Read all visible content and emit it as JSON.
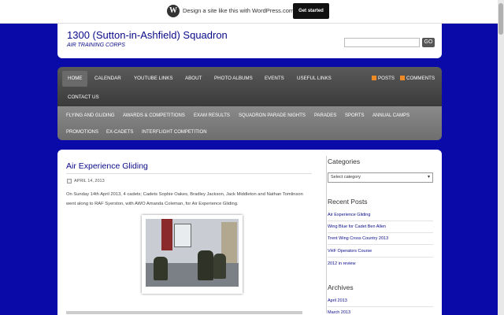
{
  "wpbar": {
    "logo_glyph": "W",
    "text": "Design a site like this with WordPress.com",
    "button": "Get started"
  },
  "header": {
    "title": "1300 (Sutton-in-Ashfield) Squadron",
    "tagline": "AIR TRAINING CORPS",
    "search_button_glyph": "GO"
  },
  "nav_primary": [
    "Home",
    "Calendar",
    "Youtube Links",
    "About",
    "Photo Albums",
    "Events",
    "Useful Links",
    "Contact Us"
  ],
  "feeds": {
    "posts": "Posts",
    "comments": "Comments"
  },
  "nav_secondary": [
    "Flying and Gliding",
    "Awards & Competitions",
    "Exam Results",
    "Squadron Parade Nights",
    "Parades",
    "Sports",
    "Annual Camps",
    "Promotions",
    "Ex-Cadets",
    "Interflight Competition"
  ],
  "post": {
    "title": "Air Experience Gliding",
    "date": "April 14, 2013",
    "body": "On Sunday 14th April 2013, 4 cadets; Cadets Sophie Oakes, Bradley Jackson, Jack Middleton and Nathan Tomlinson went along to RAF Syerston, with AWO Amanda Coleman, for Air Experience Gliding."
  },
  "sidebar": {
    "categories_title": "Categories",
    "categories_select": "Select category",
    "recent_title": "Recent Posts",
    "recent": [
      "Air Experience Gliding",
      "Wing Blue for Cadet Ben Allen",
      "Trent Wing Cross Country 2013",
      "VHF Operators Course",
      "2012 in review"
    ],
    "archives_title": "Archives",
    "archives": [
      "April 2013",
      "March 2013"
    ]
  },
  "colors": {
    "background": "#0a0aa8",
    "title": "#0a0a8a",
    "nav": "#4a4a4a",
    "rss": "#f08a24"
  }
}
